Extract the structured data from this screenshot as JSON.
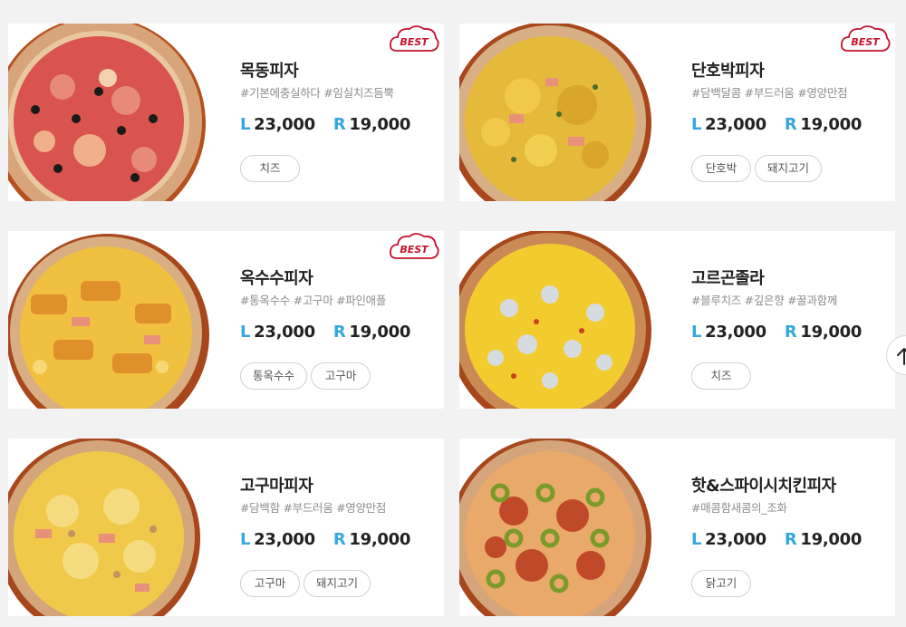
{
  "menu": {
    "items": [
      {
        "name": "목동피자",
        "tags": "#기본에충실하다 #임실치즈듬뿍",
        "size_l": "L",
        "price_l": "23,000",
        "size_r": "R",
        "price_r": "19,000",
        "toppings": [
          "치즈"
        ],
        "best": true,
        "badge": "BEST"
      },
      {
        "name": "단호박피자",
        "tags": "#담백달콤 #부드러움 #영양만점",
        "size_l": "L",
        "price_l": "23,000",
        "size_r": "R",
        "price_r": "19,000",
        "toppings": [
          "단호박",
          "돼지고기"
        ],
        "best": true,
        "badge": "BEST"
      },
      {
        "name": "옥수수피자",
        "tags": "#통옥수수 #고구마 #파인애플",
        "size_l": "L",
        "price_l": "23,000",
        "size_r": "R",
        "price_r": "19,000",
        "toppings": [
          "통옥수수",
          "고구마"
        ],
        "best": true,
        "badge": "BEST"
      },
      {
        "name": "고르곤졸라",
        "tags": "#블루치즈 #깊은향 #꿀과함께",
        "size_l": "L",
        "price_l": "23,000",
        "size_r": "R",
        "price_r": "19,000",
        "toppings": [
          "치즈"
        ],
        "best": false
      },
      {
        "name": "고구마피자",
        "tags": "#담백함 #부드러움 #영양만점",
        "size_l": "L",
        "price_l": "23,000",
        "size_r": "R",
        "price_r": "19,000",
        "toppings": [
          "고구마",
          "돼지고기"
        ],
        "best": false
      },
      {
        "name": "핫&스파이시치킨피자",
        "tags": "#매콤함새콤의_조화",
        "size_l": "L",
        "price_l": "23,000",
        "size_r": "R",
        "price_r": "19,000",
        "toppings": [
          "닭고기"
        ],
        "best": false
      }
    ]
  },
  "icons": {
    "best_badge": "cloud-best-badge",
    "scroll_top": "arrow-up-icon"
  },
  "colors": {
    "price_size": "#35a7dc",
    "best_red": "#c8102e",
    "background": "#f2f2f2"
  }
}
